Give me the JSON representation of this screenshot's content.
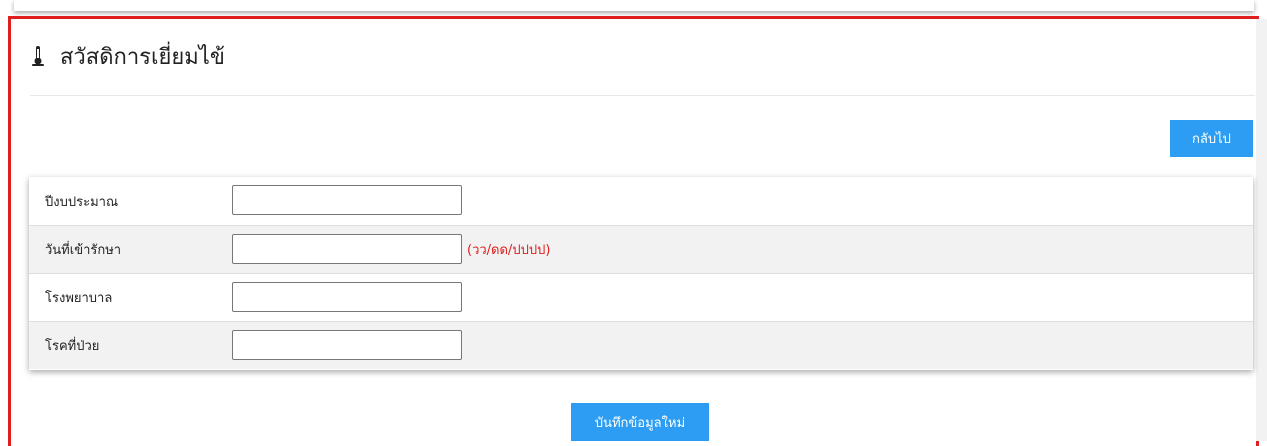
{
  "page": {
    "title": "สวัสดิการเยี่ยมไข้",
    "title_icon": "thermometer-icon",
    "accent_color": "#2c9df2",
    "frame_color": "#e01e1e"
  },
  "actions": {
    "back_label": "กลับไป",
    "save_label": "บันทึกข้อมูลใหม่"
  },
  "form": {
    "fields": [
      {
        "label": "ปีงบประมาณ",
        "value": "",
        "hint": ""
      },
      {
        "label": "วันที่เข้ารักษา",
        "value": "",
        "hint": "(วว/ดด/ปปปป)"
      },
      {
        "label": "โรงพยาบาล",
        "value": "",
        "hint": ""
      },
      {
        "label": "โรคที่ป่วย",
        "value": "",
        "hint": ""
      }
    ]
  }
}
